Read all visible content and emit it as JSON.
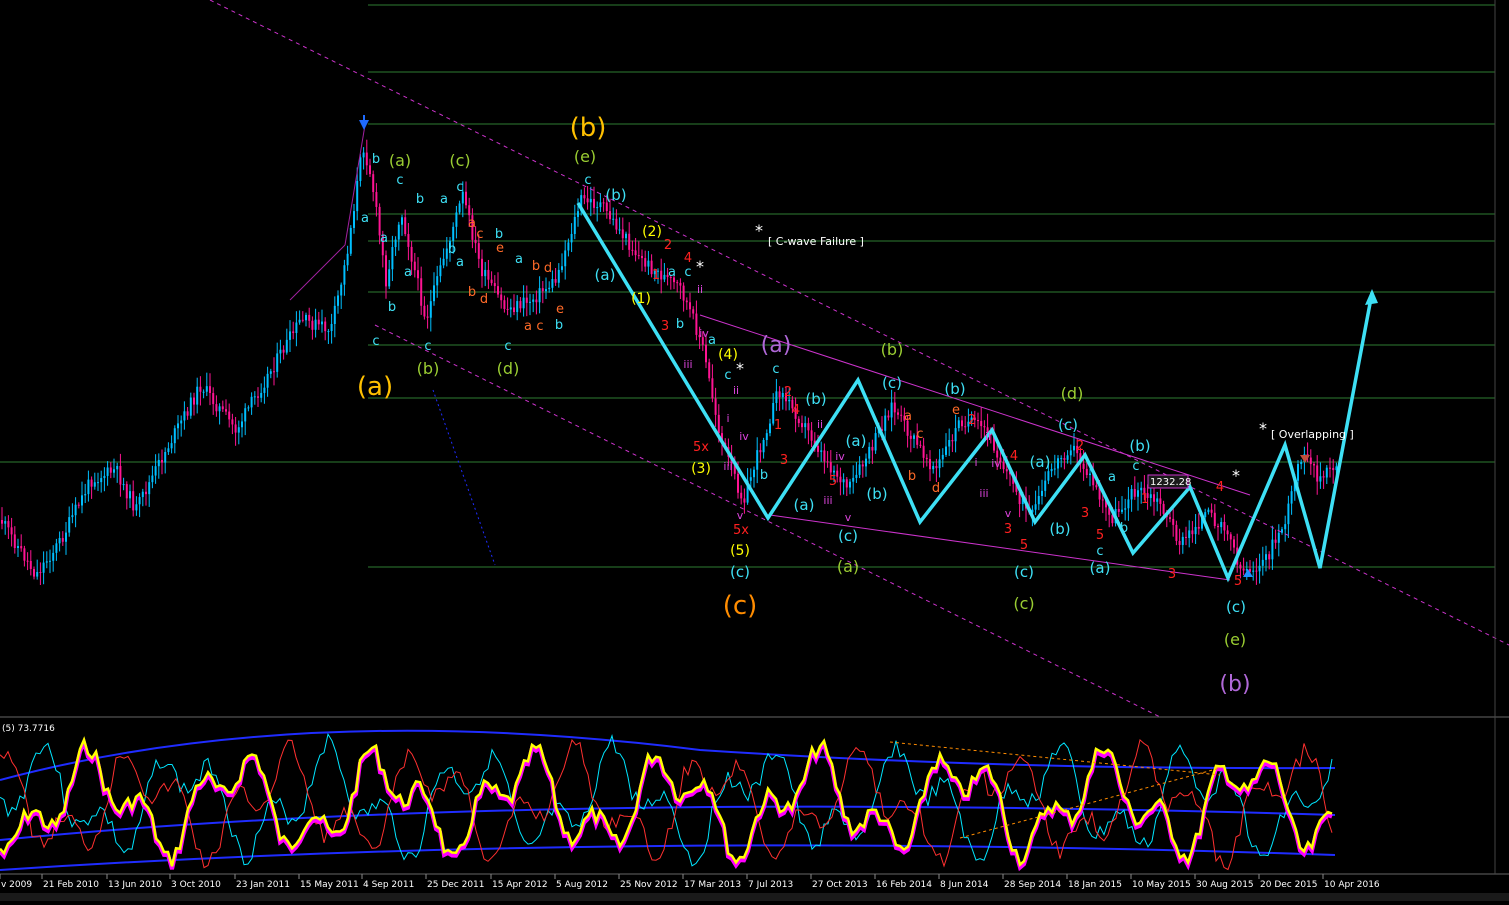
{
  "chart_data": [
    {
      "type": "candlestick",
      "panel": "price",
      "price_label": "1232.28",
      "annotations": [
        "[ C-wave Failure ]",
        "[ Overlapping ]"
      ],
      "wave_labels": {
        "major": [
          "(a)",
          "(b)",
          "(c)"
        ],
        "sub": [
          "(a)",
          "(b)",
          "(c)",
          "(d)",
          "(e)",
          "(b)",
          "(a)",
          "(b)",
          "(c)",
          "(d)",
          "(e)"
        ],
        "minor": [
          "a",
          "b",
          "c",
          "d",
          "e",
          "1",
          "2",
          "3",
          "4",
          "5",
          "5x",
          "i",
          "ii",
          "iii",
          "iv",
          "v",
          "(1)",
          "(2)",
          "(3)",
          "(4)",
          "(5)",
          "*"
        ]
      },
      "colors": {
        "bull": "#00bfff",
        "bear": "#ff1493",
        "projection": "#3ee0f5",
        "channel": "#cc33cc",
        "grid": "#2e7d32",
        "background": "#000000"
      }
    },
    {
      "type": "line",
      "panel": "oscillator",
      "title": "(5) 73.7716",
      "series_colors": [
        "#ffff00",
        "#ff00ff",
        "#00e5ff",
        "#ff3030",
        "#1f2cff"
      ]
    }
  ],
  "x_axis_labels": [
    "v 2009",
    "21 Feb 2010",
    "13 Jun 2010",
    "3 Oct 2010",
    "23 Jan 2011",
    "15 May 2011",
    "4 Sep 2011",
    "25 Dec 2011",
    "15 Apr 2012",
    "5 Aug 2012",
    "25 Nov 2012",
    "17 Mar 2013",
    "7 Jul 2013",
    "27 Oct 2013",
    "16 Feb 2014",
    "8 Jun 2014",
    "28 Sep 2014",
    "18 Jan 2015",
    "10 May 2015",
    "30 Aug 2015",
    "20 Dec 2015",
    "10 Apr 2016"
  ]
}
